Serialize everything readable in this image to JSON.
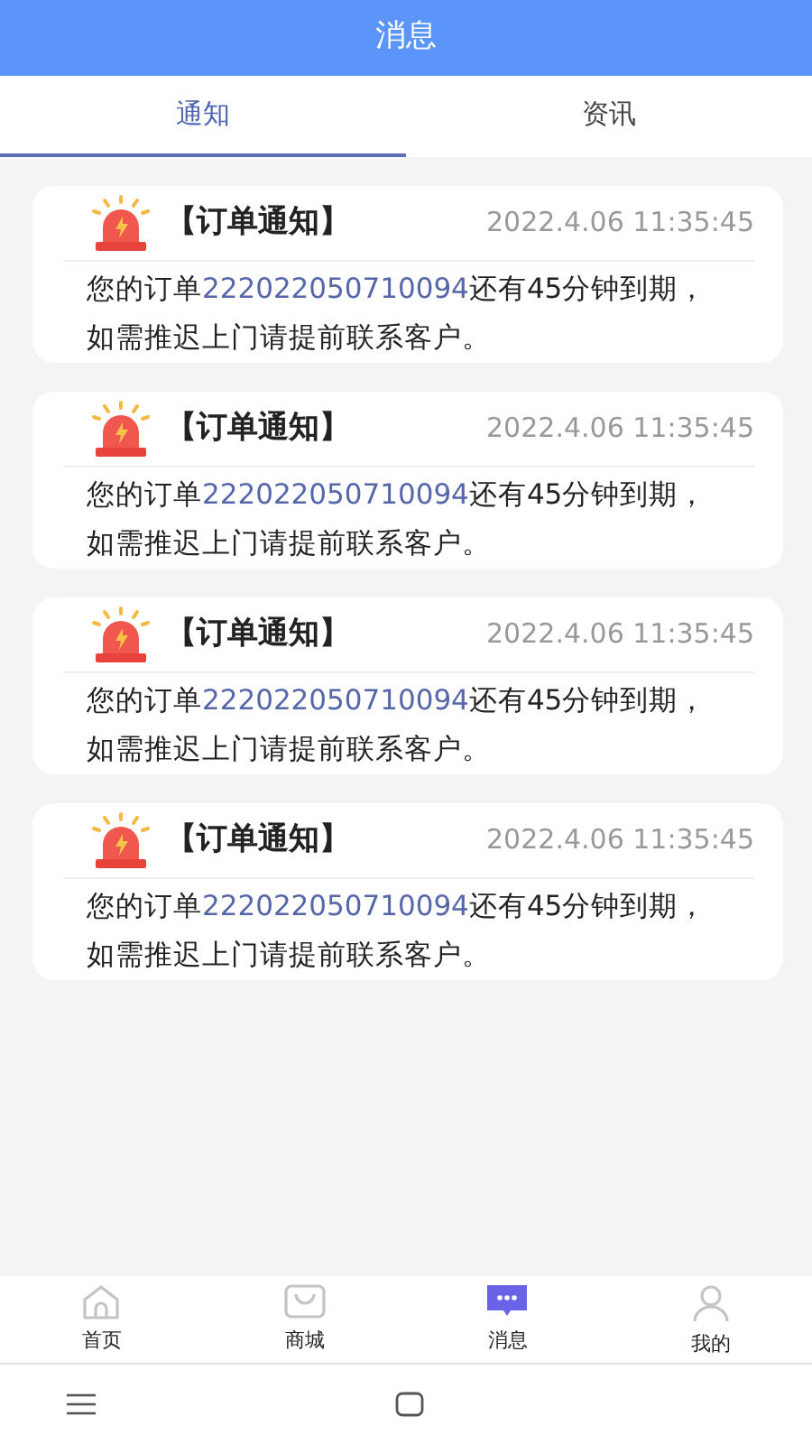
{
  "header": {
    "title": "消息"
  },
  "tabs": [
    {
      "label": "通知",
      "selected": true
    },
    {
      "label": "资讯",
      "selected": false
    }
  ],
  "notifications": [
    {
      "title": "【订单通知】",
      "time": "2022.4.06 11:35:45",
      "text_before": "您的订单",
      "order_number": "222022050710094",
      "text_after": "还有45分钟到期，如需推迟上门请提前联系客户。"
    },
    {
      "title": "【订单通知】",
      "time": "2022.4.06 11:35:45",
      "text_before": "您的订单",
      "order_number": "222022050710094",
      "text_after": "还有45分钟到期，如需推迟上门请提前联系客户。"
    },
    {
      "title": "【订单通知】",
      "time": "2022.4.06 11:35:45",
      "text_before": "您的订单",
      "order_number": "222022050710094",
      "text_after": "还有45分钟到期，如需推迟上门请提前联系客户。"
    },
    {
      "title": "【订单通知】",
      "time": "2022.4.06 11:35:45",
      "text_before": "您的订单",
      "order_number": "222022050710094",
      "text_after": "还有45分钟到期，如需推迟上门请提前联系客户。"
    }
  ],
  "bottom_nav": [
    {
      "kind": "home",
      "label": "首页",
      "selected": false
    },
    {
      "kind": "shop",
      "label": "商城",
      "selected": false
    },
    {
      "kind": "messages",
      "label": "消息",
      "selected": true
    },
    {
      "kind": "profile",
      "label": "我的",
      "selected": false
    }
  ]
}
